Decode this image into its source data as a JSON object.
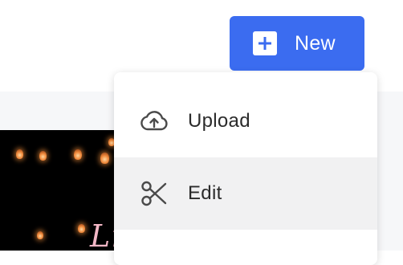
{
  "toolbar": {
    "new_label": "New"
  },
  "menu": {
    "items": [
      {
        "label": "Upload",
        "icon": "cloud-upload-icon"
      },
      {
        "label": "Edit",
        "icon": "scissors-icon"
      }
    ]
  },
  "thumbnail": {
    "overlay_text": "Li"
  },
  "colors": {
    "accent": "#3b6cf0",
    "hover": "#f1f1f2",
    "content_bg": "#f6f7f9"
  }
}
